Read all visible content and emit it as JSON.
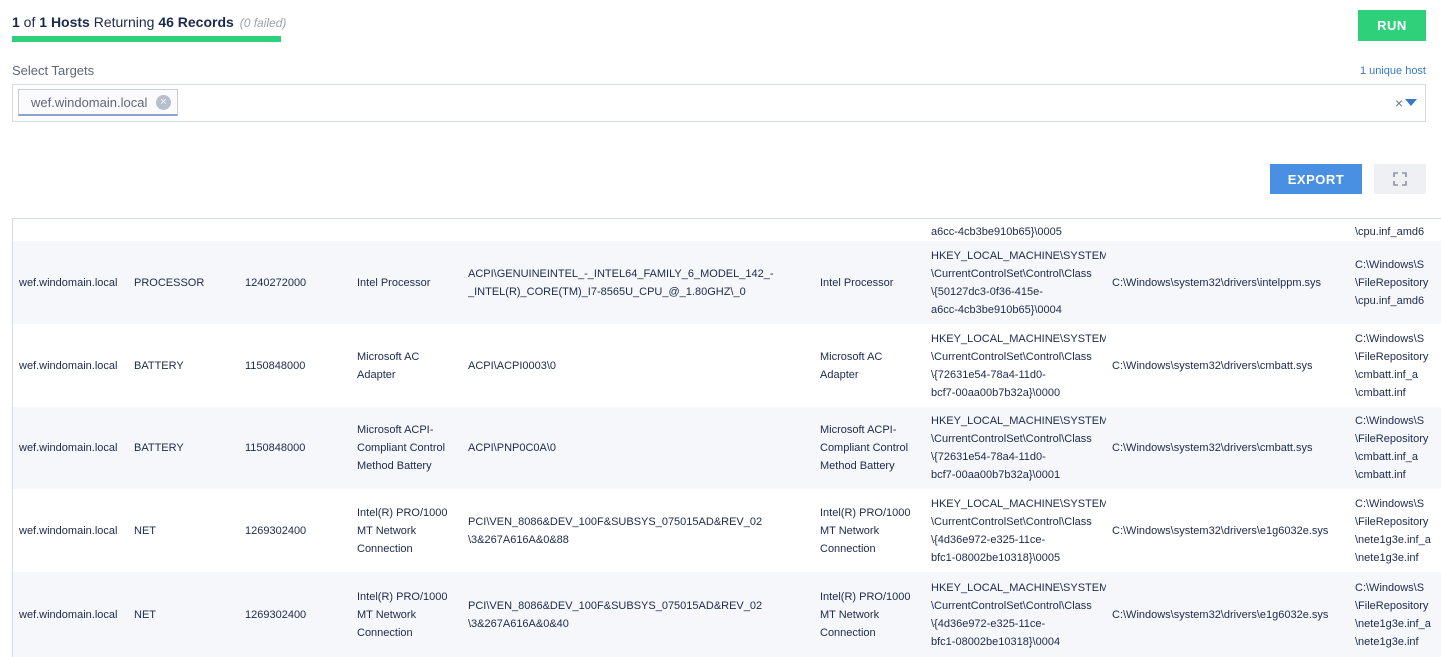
{
  "status": {
    "count_done": "1",
    "of_label": " of ",
    "hosts_label": "1 Hosts",
    "returning_label": " Returning ",
    "records_label": "46 Records",
    "failed_label": "(0 failed)",
    "progress_fraction": 1.0
  },
  "toolbar": {
    "run_label": "RUN",
    "export_label": "EXPORT"
  },
  "targets": {
    "label": "Select Targets",
    "unique_host_label": "1 unique host",
    "chip_label": "wef.windomain.local",
    "clear_symbol": "×"
  },
  "colors": {
    "accent_green": "#2fd07a",
    "accent_blue": "#4a90e2",
    "link_blue": "#3a78c9"
  },
  "table": {
    "partial_top_row": {
      "key": "a6cc-4cb3be910b65}\\0005",
      "inf": "\\cpu.inf_amd6"
    },
    "rows": [
      {
        "host": "wef.windomain.local",
        "class": "PROCESSOR",
        "date": "1240272000",
        "desc": "Intel Processor",
        "devid": "ACPI\\GENUINEINTEL_-_INTEL64_FAMILY_6_MODEL_142_-\n_INTEL(R)_CORE(TM)_I7-8565U_CPU_@_1.80GHZ\\_0",
        "name": "Intel Processor",
        "key": "HKEY_LOCAL_MACHINE\\SYSTEM\n\\CurrentControlSet\\Control\\Class\n\\{50127dc3-0f36-415e-\na6cc-4cb3be910b65}\\0004",
        "svc": "C:\\Windows\\system32\\drivers\\intelppm.sys",
        "inf": "C:\\Windows\\S\n\\FileRepository\n\\cpu.inf_amd6"
      },
      {
        "host": "wef.windomain.local",
        "class": "BATTERY",
        "date": "1150848000",
        "desc": "Microsoft AC\nAdapter",
        "devid": "ACPI\\ACPI0003\\0",
        "name": "Microsoft AC\nAdapter",
        "key": "HKEY_LOCAL_MACHINE\\SYSTEM\n\\CurrentControlSet\\Control\\Class\n\\{72631e54-78a4-11d0-\nbcf7-00aa00b7b32a}\\0000",
        "svc": "C:\\Windows\\system32\\drivers\\cmbatt.sys",
        "inf": "C:\\Windows\\S\n\\FileRepository\n\\cmbatt.inf_a\n\\cmbatt.inf"
      },
      {
        "host": "wef.windomain.local",
        "class": "BATTERY",
        "date": "1150848000",
        "desc": "Microsoft ACPI-\nCompliant Control\nMethod Battery",
        "devid": "ACPI\\PNP0C0A\\0",
        "name": "Microsoft ACPI-\nCompliant Control\nMethod Battery",
        "key": "HKEY_LOCAL_MACHINE\\SYSTEM\n\\CurrentControlSet\\Control\\Class\n\\{72631e54-78a4-11d0-\nbcf7-00aa00b7b32a}\\0001",
        "svc": "C:\\Windows\\system32\\drivers\\cmbatt.sys",
        "inf": "C:\\Windows\\S\n\\FileRepository\n\\cmbatt.inf_a\n\\cmbatt.inf"
      },
      {
        "host": "wef.windomain.local",
        "class": "NET",
        "date": "1269302400",
        "desc": "Intel(R) PRO/1000\nMT Network\nConnection",
        "devid": "PCI\\VEN_8086&DEV_100F&SUBSYS_075015AD&REV_02\n\\3&267A616A&0&88",
        "name": "Intel(R) PRO/1000\nMT Network\nConnection",
        "key": "HKEY_LOCAL_MACHINE\\SYSTEM\n\\CurrentControlSet\\Control\\Class\n\\{4d36e972-e325-11ce-\nbfc1-08002be10318}\\0005",
        "svc": "C:\\Windows\\system32\\drivers\\e1g6032e.sys",
        "inf": "C:\\Windows\\S\n\\FileRepository\n\\nete1g3e.inf_a\n\\nete1g3e.inf"
      },
      {
        "host": "wef.windomain.local",
        "class": "NET",
        "date": "1269302400",
        "desc": "Intel(R) PRO/1000\nMT Network\nConnection",
        "devid": "PCI\\VEN_8086&DEV_100F&SUBSYS_075015AD&REV_02\n\\3&267A616A&0&40",
        "name": "Intel(R) PRO/1000\nMT Network\nConnection",
        "key": "HKEY_LOCAL_MACHINE\\SYSTEM\n\\CurrentControlSet\\Control\\Class\n\\{4d36e972-e325-11ce-\nbfc1-08002be10318}\\0004",
        "svc": "C:\\Windows\\system32\\drivers\\e1g6032e.sys",
        "inf": "C:\\Windows\\S\n\\FileRepository\n\\nete1g3e.inf_a\n\\nete1g3e.inf"
      }
    ]
  }
}
